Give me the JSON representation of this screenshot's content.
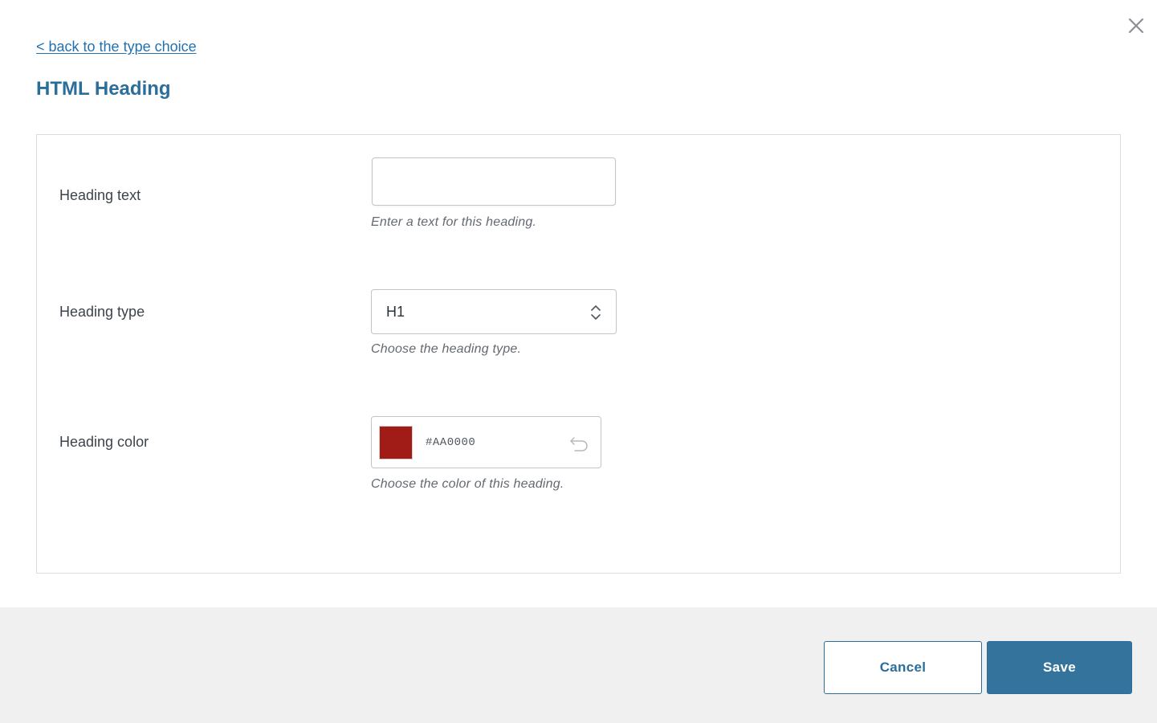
{
  "header": {
    "back_link": "< back to the type choice",
    "title": "HTML Heading",
    "close_icon": "close-icon"
  },
  "form": {
    "heading_text": {
      "label": "Heading text",
      "value": "",
      "description": "Enter a text for this heading."
    },
    "heading_type": {
      "label": "Heading type",
      "value": "H1",
      "description": "Choose the heading type."
    },
    "heading_color": {
      "label": "Heading color",
      "value": "#AA0000",
      "swatch_color": "#a21c17",
      "description": "Choose the color of this heading."
    }
  },
  "footer": {
    "cancel_label": "Cancel",
    "save_label": "Save"
  },
  "colors": {
    "accent": "#2c6e9a",
    "primary_button": "#34739c",
    "footer_bg": "#f0f0f1"
  }
}
